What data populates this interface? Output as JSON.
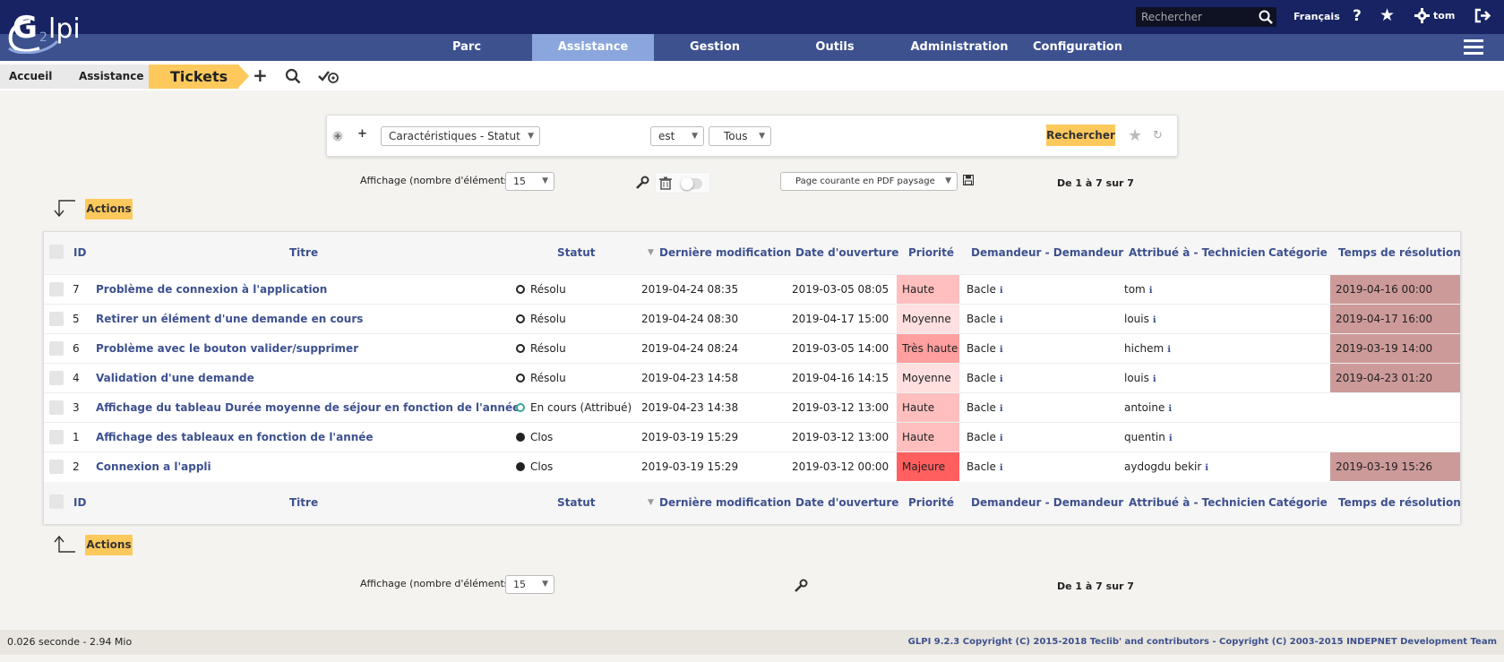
{
  "app": {
    "logo_text": "Glpi"
  },
  "topbar": {
    "search_placeholder": "Rechercher",
    "language": "Français",
    "user": "tom"
  },
  "menu": [
    {
      "label": "Parc",
      "active": false
    },
    {
      "label": "Assistance",
      "active": true
    },
    {
      "label": "Gestion",
      "active": false
    },
    {
      "label": "Outils",
      "active": false
    },
    {
      "label": "Administration",
      "active": false
    },
    {
      "label": "Configuration",
      "active": false
    }
  ],
  "breadcrumb": {
    "home": "Accueil",
    "section": "Assistance",
    "page": "Tickets"
  },
  "criteria": {
    "field": "Caractéristiques - Statut",
    "operator": "est",
    "value": "Tous",
    "search_button": "Rechercher"
  },
  "display": {
    "label": "Affichage (nombre d'éléments)",
    "count": "15",
    "export_option": "Page courante en PDF paysage",
    "pager": "De 1 à 7 sur 7",
    "actions_label": "Actions"
  },
  "table": {
    "columns": [
      "ID",
      "Titre",
      "Statut",
      "Dernière modification",
      "Date d'ouverture",
      "Priorité",
      "Demandeur - Demandeur",
      "Attribué à - Technicien",
      "Catégorie",
      "Temps de résolution"
    ],
    "sort_indicator": "▼",
    "rows": [
      {
        "id": "7",
        "title": "Problème de connexion à l'application",
        "status": "Résolu",
        "status_kind": "solved",
        "modified": "2019-04-24 08:35",
        "opened": "2019-03-05 08:05",
        "priority": "Haute",
        "priority_color": "#ffbfbf",
        "requester": "Bacle",
        "tech": "tom",
        "category": "",
        "resolution": "2019-04-16 00:00"
      },
      {
        "id": "5",
        "title": "Retirer un élément d'une demande en cours",
        "status": "Résolu",
        "status_kind": "solved",
        "modified": "2019-04-24 08:30",
        "opened": "2019-04-17 15:00",
        "priority": "Moyenne",
        "priority_color": "#ffdfdf",
        "requester": "Bacle",
        "tech": "louis",
        "category": "",
        "resolution": "2019-04-17 16:00"
      },
      {
        "id": "6",
        "title": "Problème avec le bouton valider/supprimer",
        "status": "Résolu",
        "status_kind": "solved",
        "modified": "2019-04-24 08:24",
        "opened": "2019-03-05 14:00",
        "priority": "Très haute",
        "priority_color": "#ff9f9f",
        "requester": "Bacle",
        "tech": "hichem",
        "category": "",
        "resolution": "2019-03-19 14:00"
      },
      {
        "id": "4",
        "title": "Validation d'une demande",
        "status": "Résolu",
        "status_kind": "solved",
        "modified": "2019-04-23 14:58",
        "opened": "2019-04-16 14:15",
        "priority": "Moyenne",
        "priority_color": "#ffdfdf",
        "requester": "Bacle",
        "tech": "louis",
        "category": "",
        "resolution": "2019-04-23 01:20"
      },
      {
        "id": "3",
        "title": "Affichage du tableau Durée moyenne de séjour en fonction de l'année",
        "status": "En cours (Attribué)",
        "status_kind": "assigned",
        "modified": "2019-04-23 14:38",
        "opened": "2019-03-12 13:00",
        "priority": "Haute",
        "priority_color": "#ffbfbf",
        "requester": "Bacle",
        "tech": "antoine",
        "category": "",
        "resolution": ""
      },
      {
        "id": "1",
        "title": "Affichage des tableaux en fonction de l'année",
        "status": "Clos",
        "status_kind": "closed",
        "modified": "2019-03-19 15:29",
        "opened": "2019-03-12 13:00",
        "priority": "Haute",
        "priority_color": "#ffbfbf",
        "requester": "Bacle",
        "tech": "quentin",
        "category": "",
        "resolution": ""
      },
      {
        "id": "2",
        "title": "Connexion a l'appli",
        "status": "Clos",
        "status_kind": "closed",
        "modified": "2019-03-19 15:29",
        "opened": "2019-03-12 00:00",
        "priority": "Majeure",
        "priority_color": "#ff5f5f",
        "requester": "Bacle",
        "tech": "aydogdu bekir",
        "category": "",
        "resolution": "2019-03-19 15:26"
      }
    ]
  },
  "footer": {
    "timing": "0.026 seconde - 2.94 Mio",
    "copyright": "GLPI 9.2.3 Copyright (C) 2015-2018 Teclib' and contributors - Copyright (C) 2003-2015 INDEPNET Development Team"
  },
  "colors": {
    "topbar": "#172362",
    "menubar": "#3d518f",
    "active_menu": "#8aa6dc",
    "accent_yellow": "#fec95c",
    "resolution_bg": "#cd9a9a"
  }
}
